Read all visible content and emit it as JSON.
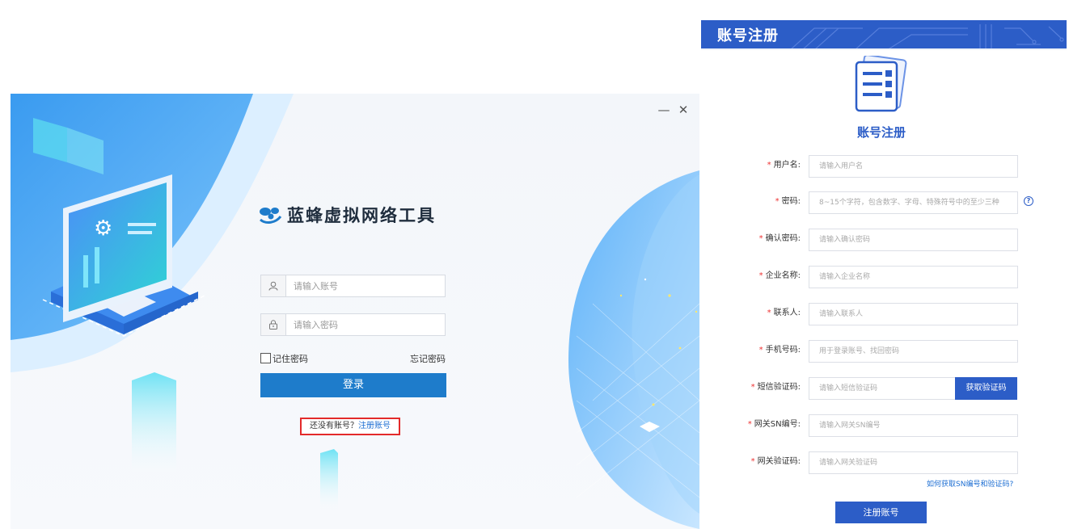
{
  "login": {
    "app_title": "蓝蜂虚拟网络工具",
    "window": {
      "minimize_glyph": "—",
      "close_glyph": "✕"
    },
    "username": {
      "placeholder": "请输入账号",
      "icon": "user-icon"
    },
    "password": {
      "placeholder": "请输入密码",
      "icon": "lock-icon"
    },
    "remember_label": "记住密码",
    "forgot_label": "忘记密码",
    "login_button": "登录",
    "no_account_text": "还没有账号？",
    "register_link": "注册账号"
  },
  "register": {
    "header_title": "账号注册",
    "title": "账号注册",
    "fields": [
      {
        "label": "用户名:",
        "placeholder": "请输入用户名"
      },
      {
        "label": "密码:",
        "placeholder": "8~15个字符，包含数字、字母、特殊符号中的至少三种"
      },
      {
        "label": "确认密码:",
        "placeholder": "请输入确认密码"
      },
      {
        "label": "企业名称:",
        "placeholder": "请输入企业名称"
      },
      {
        "label": "联系人:",
        "placeholder": "请输入联系人"
      },
      {
        "label": "手机号码:",
        "placeholder": "用于登录账号、找回密码"
      },
      {
        "label": "短信验证码:",
        "placeholder": "请输入短信验证码"
      },
      {
        "label": "网关SN编号:",
        "placeholder": "请输入网关SN编号"
      },
      {
        "label": "网关验证码:",
        "placeholder": "请输入网关验证码"
      }
    ],
    "required_mark": "*",
    "sms_button": "获取验证码",
    "help_glyph": "?",
    "sn_help_link": "如何获取SN编号和验证码?",
    "submit_button": "注册账号"
  },
  "colors": {
    "primary": "#1e7ccb",
    "register_blue": "#2c5dc7",
    "highlight_red": "#e32a2a",
    "link": "#1e6fd3"
  }
}
